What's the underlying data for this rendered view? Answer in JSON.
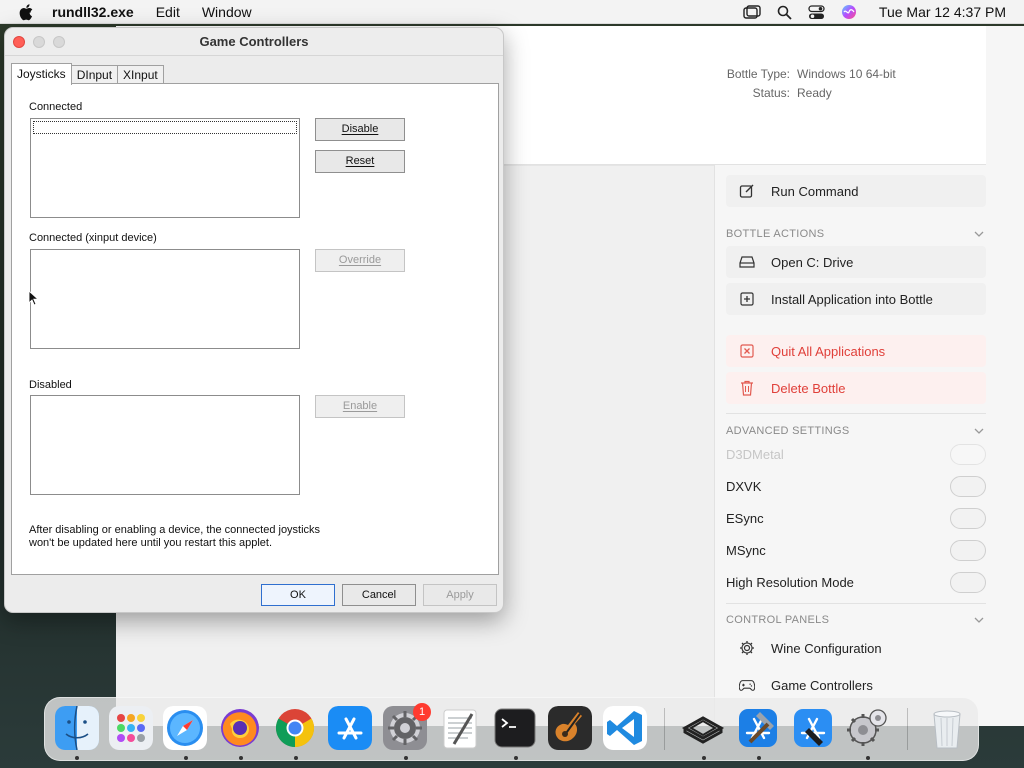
{
  "menubar": {
    "app_name": "rundll32.exe",
    "menus": [
      "Edit",
      "Window"
    ],
    "clock": "Tue Mar 12  4:37 PM"
  },
  "bottle_info": {
    "type_label": "Bottle Type:",
    "type_value": "Windows 10 64-bit",
    "status_label": "Status:",
    "status_value": "Ready"
  },
  "actions": {
    "run_command": "Run Command",
    "bottle_actions_header": "BOTTLE ACTIONS",
    "open_drive": "Open C: Drive",
    "install_app": "Install Application into Bottle",
    "quit_all": "Quit All Applications",
    "delete_bottle": "Delete Bottle"
  },
  "advanced": {
    "header": "ADVANCED SETTINGS",
    "d3dmetal": "D3DMetal",
    "dxvk": "DXVK",
    "esync": "ESync",
    "msync": "MSync",
    "high_res": "High Resolution Mode"
  },
  "control_panels": {
    "header": "CONTROL PANELS",
    "wine_config": "Wine Configuration",
    "game_controllers": "Game Controllers"
  },
  "dialog": {
    "title": "Game Controllers",
    "tabs": [
      "Joysticks",
      "DInput",
      "XInput"
    ],
    "connected_label": "Connected",
    "xinput_label": "Connected (xinput device)",
    "disabled_label": "Disabled",
    "disable_btn": "Disable",
    "reset_btn": "Reset",
    "override_btn": "Override",
    "enable_btn": "Enable",
    "note_line1": "After disabling or enabling a device, the connected joysticks",
    "note_line2": "won't be updated here until you restart this applet.",
    "ok_btn": "OK",
    "cancel_btn": "Cancel",
    "apply_btn": "Apply"
  },
  "dock": {
    "settings_badge": "1"
  },
  "colors": {
    "danger": "#e0403a",
    "accent": "#2f6fcf",
    "close_button": "#ff5f57"
  }
}
